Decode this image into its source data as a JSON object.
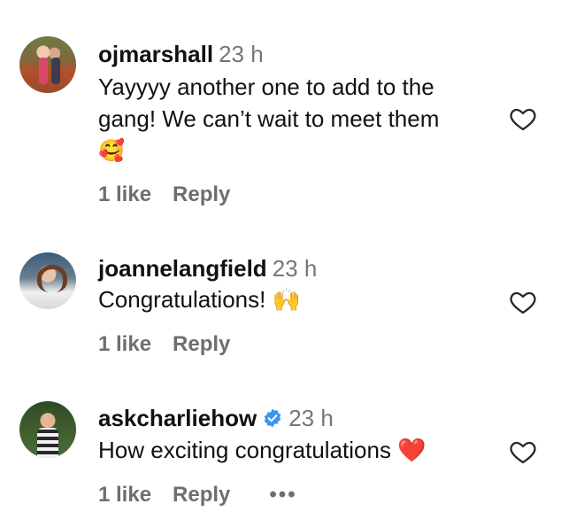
{
  "comments": [
    {
      "username": "ojmarshall",
      "time": "23 h",
      "text_line1": "Yayyyy another one to add to the",
      "text_line2": "gang! We can’t wait to meet them",
      "text_line3": "🥰",
      "likes": "1 like",
      "reply": "Reply",
      "verified": false
    },
    {
      "username": "joannelangfield",
      "time": "23 h",
      "text_line1": "Congratulations! 🙌",
      "likes": "1 like",
      "reply": "Reply",
      "verified": false
    },
    {
      "username": "askcharliehow",
      "time": "23 h",
      "text_line1": "How exciting congratulations ❤️",
      "likes": "1 like",
      "reply": "Reply",
      "more": "•••",
      "verified": true
    }
  ],
  "icons": {
    "like": "heart-outline-icon",
    "verified": "verified-badge-icon",
    "more": "more-options-icon"
  },
  "colors": {
    "verified_blue": "#3897f0",
    "meta_gray": "#6e6e6e",
    "time_gray": "#767676"
  }
}
